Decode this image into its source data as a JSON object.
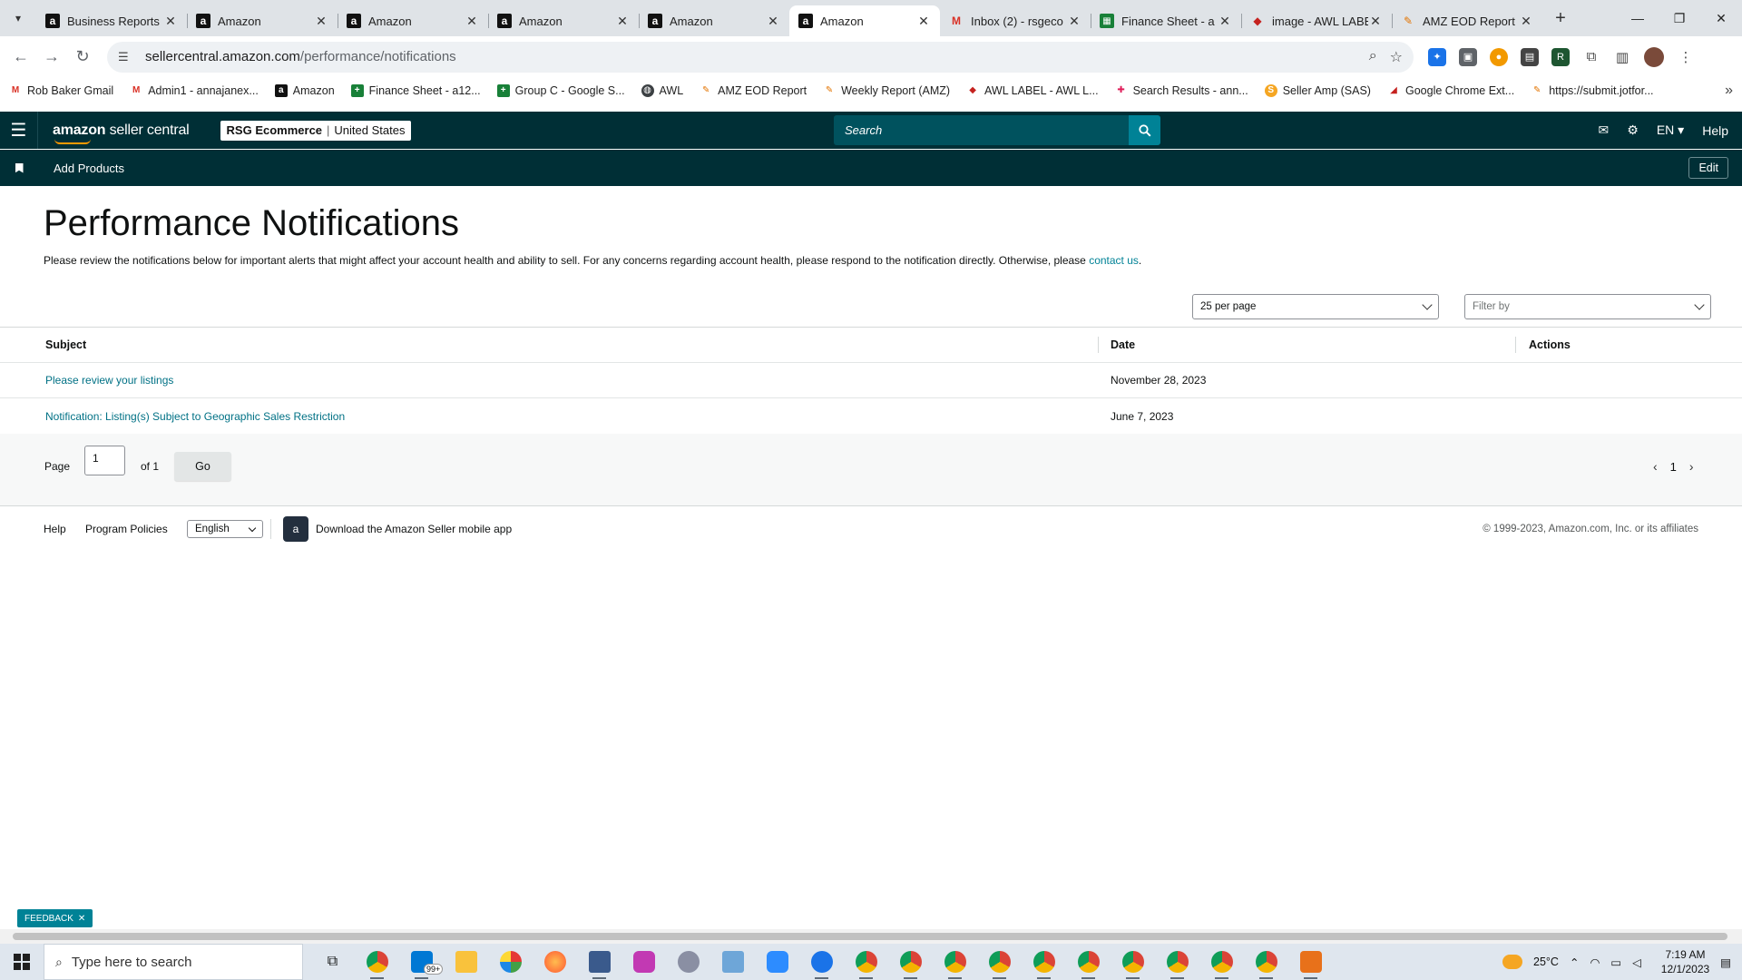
{
  "browser": {
    "tabs": [
      {
        "title": "Business Reports",
        "favicon": "amazon",
        "active": false
      },
      {
        "title": "Amazon",
        "favicon": "amazon",
        "active": false
      },
      {
        "title": "Amazon",
        "favicon": "amazon",
        "active": false
      },
      {
        "title": "Amazon",
        "favicon": "amazon",
        "active": false
      },
      {
        "title": "Amazon",
        "favicon": "amazon",
        "active": false
      },
      {
        "title": "Amazon",
        "favicon": "amazon",
        "active": true
      },
      {
        "title": "Inbox (2) - rsgeco",
        "favicon": "gmail",
        "active": false
      },
      {
        "title": "Finance Sheet - a",
        "favicon": "sheets",
        "active": false
      },
      {
        "title": "image - AWL LABE",
        "favicon": "awl",
        "active": false
      },
      {
        "title": "AMZ EOD Report",
        "favicon": "eod",
        "active": false
      }
    ],
    "url_host": "sellercentral.amazon.com",
    "url_path": "/performance/notifications",
    "bookmarks": [
      {
        "label": "Rob Baker Gmail",
        "icon": "gmail"
      },
      {
        "label": "Admin1 - annajanex...",
        "icon": "gmail"
      },
      {
        "label": "Amazon",
        "icon": "amazon"
      },
      {
        "label": "Finance Sheet - a12...",
        "icon": "sheets"
      },
      {
        "label": "Group C - Google S...",
        "icon": "sheets"
      },
      {
        "label": "AWL",
        "icon": "globe"
      },
      {
        "label": "AMZ EOD Report",
        "icon": "eod"
      },
      {
        "label": "Weekly Report (AMZ)",
        "icon": "eod"
      },
      {
        "label": "AWL LABEL - AWL L...",
        "icon": "awl"
      },
      {
        "label": "Search Results - ann...",
        "icon": "slack"
      },
      {
        "label": "Seller Amp (SAS)",
        "icon": "sas"
      },
      {
        "label": "Google Chrome Ext...",
        "icon": "awl"
      },
      {
        "label": "https://submit.jotfor...",
        "icon": "eod"
      }
    ]
  },
  "header": {
    "logo_bold": "amazon",
    "logo_light": " seller central",
    "account_name": "RSG Ecommerce",
    "account_region": "United States",
    "search_placeholder": "Search",
    "language": "EN",
    "help": "Help"
  },
  "subnav": {
    "add_products": "Add Products",
    "edit": "Edit"
  },
  "main": {
    "title": "Performance Notifications",
    "intro": "Please review the notifications below for important alerts that might affect your account health and ability to sell. For any concerns regarding account health, please respond to the notification directly. Otherwise, please ",
    "intro_link": "contact us",
    "intro_end": ".",
    "per_page": "25 per page",
    "filter_placeholder": "Filter by",
    "columns": {
      "subject": "Subject",
      "date": "Date",
      "actions": "Actions"
    },
    "rows": [
      {
        "subject": "Please review your listings",
        "date": "November 28, 2023"
      },
      {
        "subject": "Notification: Listing(s) Subject to Geographic Sales Restriction",
        "date": "June 7, 2023"
      }
    ],
    "pager": {
      "page_label": "Page",
      "page_value": "1",
      "of_label": "of 1",
      "go": "Go",
      "current": "1"
    }
  },
  "footer": {
    "help": "Help",
    "policies": "Program Policies",
    "language": "English",
    "app_link": "Download the Amazon Seller mobile app",
    "copyright": "© 1999-2023, Amazon.com, Inc. or its affiliates"
  },
  "feedback": "FEEDBACK",
  "taskbar": {
    "search_placeholder": "Type here to search",
    "mail_badge": "99+",
    "temperature": "25°C",
    "time": "7:19 AM",
    "date": "12/1/2023"
  },
  "colors": {
    "header_bg": "#002f36",
    "search_btn": "#008296",
    "link": "#007185",
    "logo_accent": "#ff9900"
  }
}
